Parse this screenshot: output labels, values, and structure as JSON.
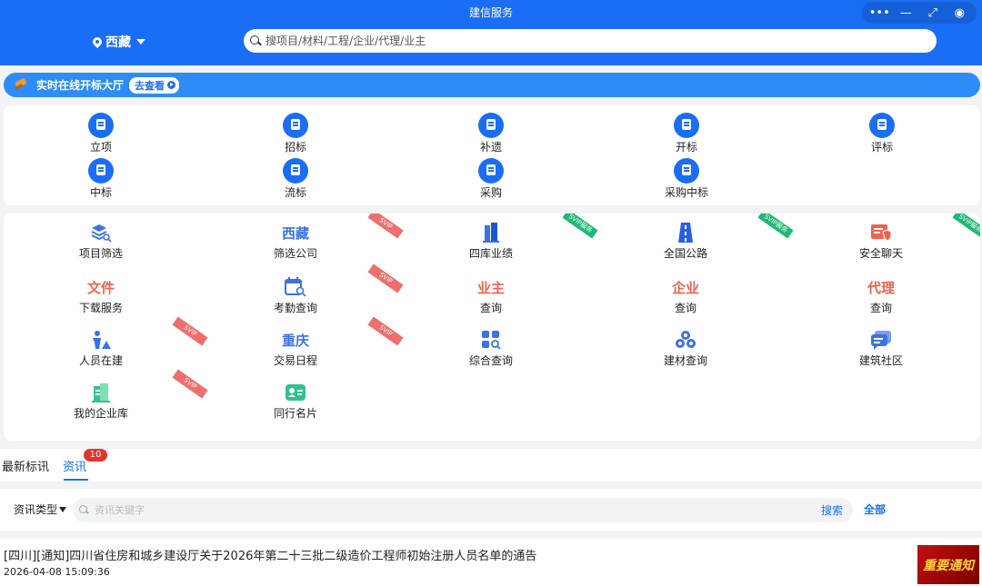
{
  "window": {
    "title": "建信服务",
    "controls": [
      "•••",
      "—",
      "⤢",
      "◉"
    ]
  },
  "header": {
    "location": "西藏",
    "search_placeholder": "搜项目/材料/工程/企业/代理/业主"
  },
  "banner": {
    "text": "实时在线开标大厅",
    "action": "去查看"
  },
  "grid1": {
    "items": [
      {
        "label": "立项"
      },
      {
        "label": "招标"
      },
      {
        "label": "补遗"
      },
      {
        "label": "开标"
      },
      {
        "label": "评标"
      },
      {
        "label": "中标"
      },
      {
        "label": "流标"
      },
      {
        "label": "采购"
      },
      {
        "label": "采购中标"
      }
    ]
  },
  "grid2": {
    "items": [
      {
        "label": "项目筛选",
        "icon": "layers-search-icon"
      },
      {
        "label": "筛选公司",
        "icon_text": "西藏",
        "ribbon": "SVIP"
      },
      {
        "label": "四库业绩",
        "icon": "building-icon",
        "ribbon": "SVIP服务"
      },
      {
        "label": "全国公路",
        "icon": "road-icon",
        "ribbon": "SVIP服务"
      },
      {
        "label": "安全聊天",
        "icon": "shield-chat-icon",
        "ribbon": "SVIP服务"
      },
      {
        "label": "下载服务",
        "icon_text": "文件"
      },
      {
        "label": "考勤查询",
        "icon": "calendar-search-icon",
        "ribbon": "SVIP"
      },
      {
        "label": "查询",
        "icon_text": "业主"
      },
      {
        "label": "查询",
        "icon_text": "企业"
      },
      {
        "label": "查询",
        "icon_text": "代理"
      },
      {
        "label": "人员在建",
        "icon": "worker-icon",
        "ribbon": "SVIP"
      },
      {
        "label": "交易日程",
        "icon_text": "重庆",
        "ribbon": "SVIP"
      },
      {
        "label": "综合查询",
        "icon": "grid-search-icon"
      },
      {
        "label": "建材查询",
        "icon": "materials-icon"
      },
      {
        "label": "建筑社区",
        "icon": "community-icon"
      },
      {
        "label": "我的企业库",
        "icon": "company-library-icon",
        "ribbon": "SVIP"
      },
      {
        "label": "同行名片",
        "icon": "card-icon"
      }
    ]
  },
  "tabs": {
    "tab1": "最新标讯",
    "tab2": "资讯",
    "badge": "10"
  },
  "filter": {
    "type_label": "资讯类型",
    "placeholder": "资讯关键字",
    "search": "搜索",
    "all": "全部"
  },
  "news": {
    "title": "[四川][通知]四川省住房和城乡建设厅关于2026年第二十三批二级造价工程师初始注册人员名单的通告",
    "time": "2026-04-08 15:09:36",
    "thumb_text": "重要通知"
  },
  "colors": {
    "primary": "#1a6ef5",
    "banner": "#2c8df8",
    "text_icon_red": "#f0624f",
    "ribbon_red": "#ef6e6b",
    "ribbon_green": "#1fb874",
    "badge": "#e5342a"
  }
}
